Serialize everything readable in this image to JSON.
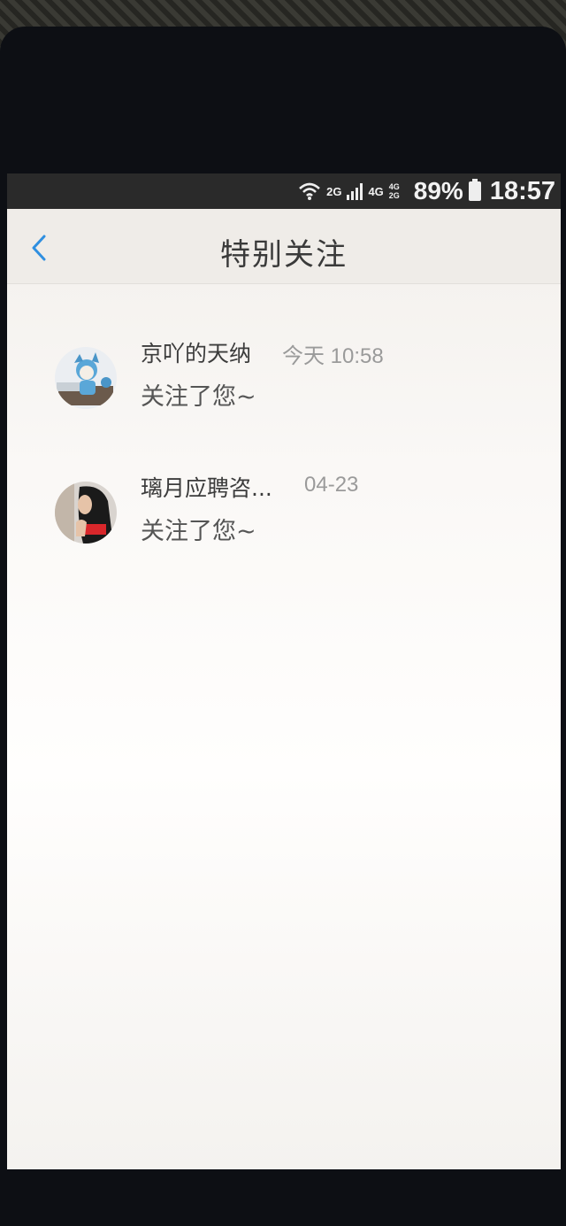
{
  "status_bar": {
    "net_2g": "2G",
    "net_4g": "4G",
    "net_small": "4G 2G",
    "battery": "89%",
    "clock": "18:57",
    "icons": [
      "wifi-icon",
      "signal-icon",
      "battery-icon"
    ]
  },
  "header": {
    "title": "特别关注",
    "back_icon": "chevron-left-icon",
    "accent": "#2f8fe0"
  },
  "items": [
    {
      "name": "京吖的天纳",
      "time": "今天 10:58",
      "message": "关注了您~"
    },
    {
      "name": "璃月应聘咨...",
      "time": "04-23",
      "message": "关注了您~"
    }
  ]
}
